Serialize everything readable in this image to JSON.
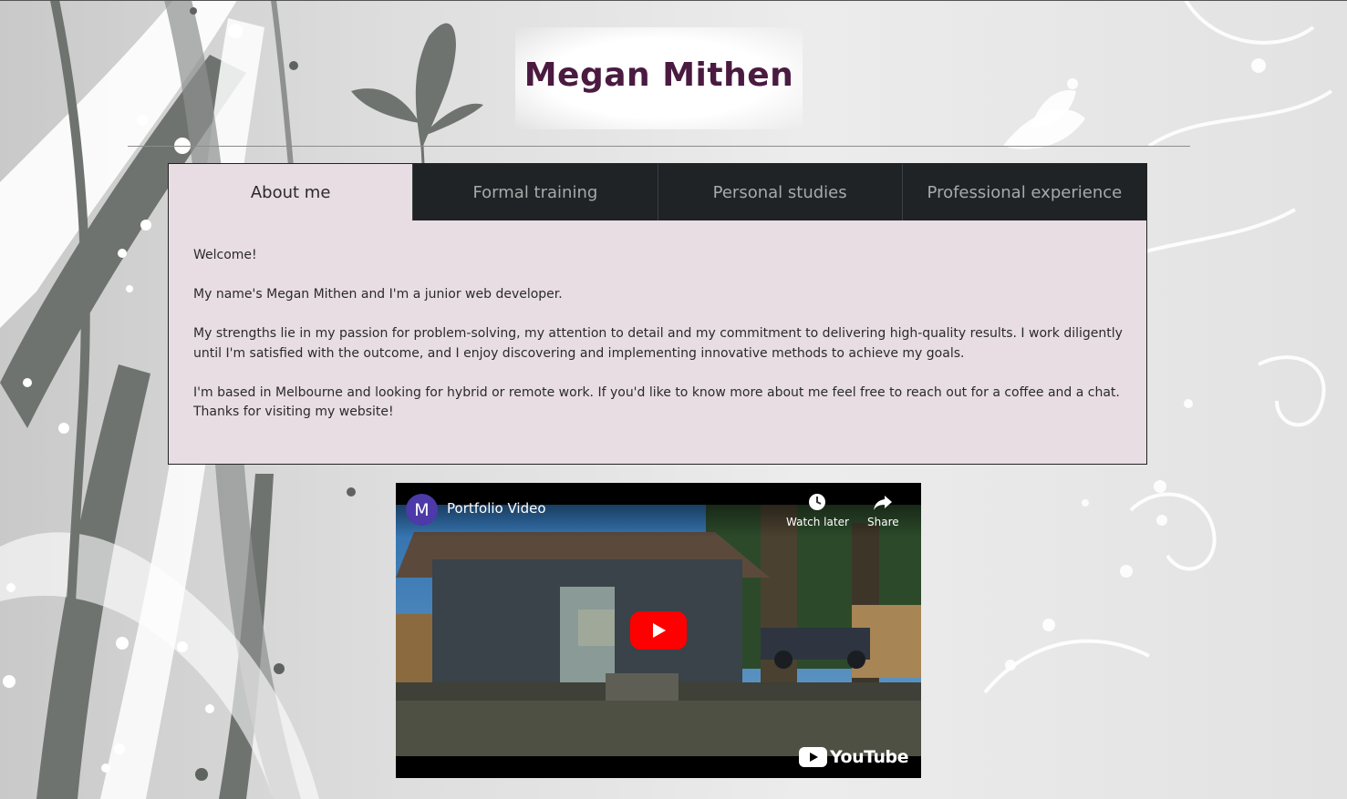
{
  "site": {
    "title": "Megan Mithen"
  },
  "tabs": [
    {
      "label": "About me",
      "active": true
    },
    {
      "label": "Formal training",
      "active": false
    },
    {
      "label": "Personal studies",
      "active": false
    },
    {
      "label": "Professional experience",
      "active": false
    }
  ],
  "about": {
    "paragraphs": [
      "Welcome!",
      "My name's Megan Mithen and I'm a junior web developer.",
      "My strengths lie in my passion for problem-solving, my attention to detail and my commitment to delivering high-quality results. I work diligently until I'm satisfied with the outcome, and I enjoy discovering and implementing innovative methods to achieve my goals.",
      "I'm based in Melbourne and looking for hybrid or remote work. If you'd like to know more about me feel free to reach out for a coffee and a chat. Thanks for visiting my website!"
    ]
  },
  "video": {
    "channel_initial": "M",
    "title": "Portfolio Video",
    "watch_later_label": "Watch later",
    "share_label": "Share",
    "brand_label": "YouTube",
    "icons": [
      "clock-icon",
      "share-arrow-icon",
      "play-icon",
      "youtube-logo"
    ]
  },
  "colors": {
    "title": "#4a1a40",
    "panel_bg": "#e8dde3",
    "tab_inactive_bg": "#1f2326",
    "tab_inactive_text": "#a9a9a9",
    "youtube_red": "#ff0000"
  }
}
